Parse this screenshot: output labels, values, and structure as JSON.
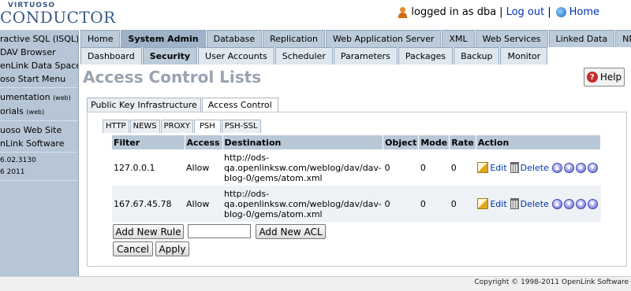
{
  "header": {
    "logo_small": "VIRTUOSO",
    "logo_big": "CONDUCTOR",
    "logged_in": "logged in as dba",
    "separator": "|",
    "logout": "Log out",
    "home": "Home"
  },
  "sidebar": {
    "items": [
      "ractive SQL (ISQL)",
      "DAV Browser",
      "enLink Data Spaces",
      "oso Start Menu"
    ],
    "docs": [
      {
        "label": "umentation ",
        "suffix": "(web)"
      },
      {
        "label": "orials ",
        "suffix": "(web)"
      }
    ],
    "links": [
      "uoso Web Site",
      "nLink Software"
    ],
    "version": [
      "6.02.3130",
      "6 2011"
    ]
  },
  "main_tabs": [
    "Home",
    "System Admin",
    "Database",
    "Replication",
    "Web Application Server",
    "XML",
    "Web Services",
    "Linked Data",
    "NNTP"
  ],
  "sub_tabs": [
    "Dashboard",
    "Security",
    "User Accounts",
    "Scheduler",
    "Parameters",
    "Packages",
    "Backup",
    "Monitor"
  ],
  "page": {
    "title": "Access Control Lists",
    "help": "Help"
  },
  "content_tabs": [
    "Public Key Infrastructure",
    "Access Control"
  ],
  "protocol_tabs": [
    "HTTP",
    "NEWS",
    "PROXY",
    "PSH",
    "PSH-SSL"
  ],
  "table": {
    "headers": [
      "Filter",
      "Access",
      "Destination",
      "Object",
      "Mode",
      "Rate",
      "Action"
    ],
    "rows": [
      {
        "filter": "127.0.0.1",
        "access": "Allow",
        "dest1": "http://ods-",
        "dest2": "qa.openlinksw.com/weblog/dav/dav-",
        "dest3": "blog-0/gems/atom.xml",
        "object": "0",
        "mode": "0",
        "rate": "0"
      },
      {
        "filter": "167.67.45.78",
        "access": "Allow",
        "dest1": "http://ods-",
        "dest2": "qa.openlinksw.com/weblog/dav/dav-",
        "dest3": "blog-0/gems/atom.xml",
        "object": "0",
        "mode": "0",
        "rate": "0"
      }
    ],
    "edit": "Edit",
    "delete": "Delete"
  },
  "buttons": {
    "add_rule": "Add New Rule",
    "add_acl": "Add New ACL",
    "cancel": "Cancel",
    "apply": "Apply"
  },
  "rule_input_value": "",
  "footer": "Copyright © 1998-2011 OpenLink Software"
}
